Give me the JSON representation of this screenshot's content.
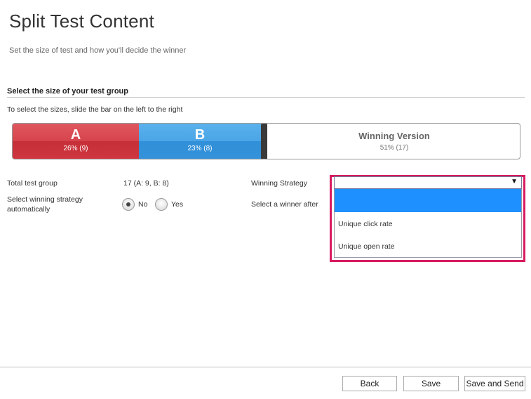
{
  "header": {
    "title": "Split Test Content",
    "subtitle": "Set the size of test and how you'll decide the winner"
  },
  "test_group": {
    "section_title": "Select the size of your test group",
    "hint": "To select the sizes, slide the bar on the left to the right",
    "segments": {
      "a": {
        "letter": "A",
        "percent_label": "26% (9)",
        "share": 0.26,
        "color": "#d6444c"
      },
      "b": {
        "letter": "B",
        "percent_label": "23% (8)",
        "share": 0.23,
        "color": "#3a9ae0"
      },
      "winner": {
        "title": "Winning Version",
        "percent_label": "51% (17)",
        "share": 0.51
      }
    }
  },
  "settings": {
    "total_label": "Total test group",
    "total_value": "17 (A: 9, B: 8)",
    "auto_label": "Select winning strategy automatically",
    "radio_no": "No",
    "radio_yes": "Yes",
    "selected": "No",
    "strategy_label": "Winning Strategy",
    "winner_after_label": "Select a winner after",
    "strategy_value": "",
    "strategy_options": [
      "",
      "Unique click rate",
      "Unique open rate"
    ]
  },
  "colors": {
    "highlight": "#d81b60",
    "option_selected": "#1e90ff"
  },
  "footer": {
    "back": "Back",
    "save": "Save",
    "save_and_send": "Save and Send"
  }
}
